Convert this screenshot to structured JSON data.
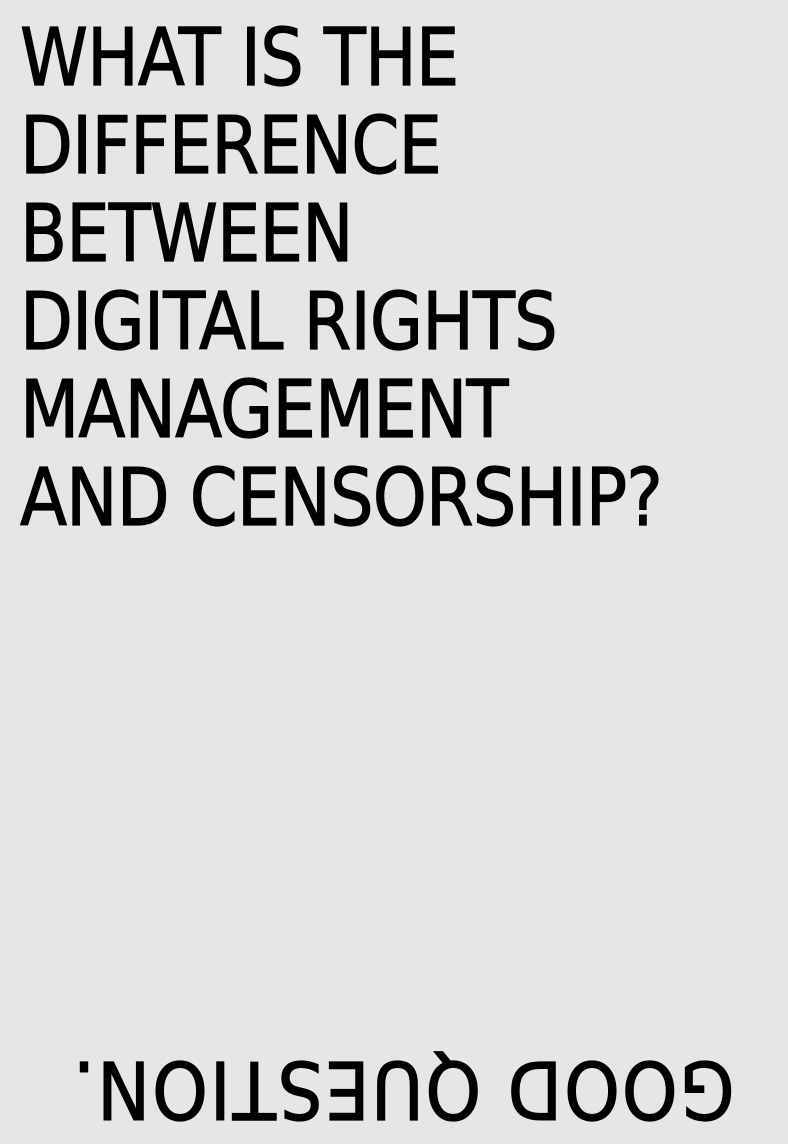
{
  "poster": {
    "question_lines": [
      "WHAT IS THE",
      "DIFFERENCE",
      "BETWEEN",
      "DIGITAL RIGHTS",
      "MANAGEMENT",
      "AND CENSORSHIP?"
    ],
    "answer": "GOOD QUESTION.",
    "colors": {
      "background": "#e6e6e6",
      "text": "#000000"
    }
  }
}
